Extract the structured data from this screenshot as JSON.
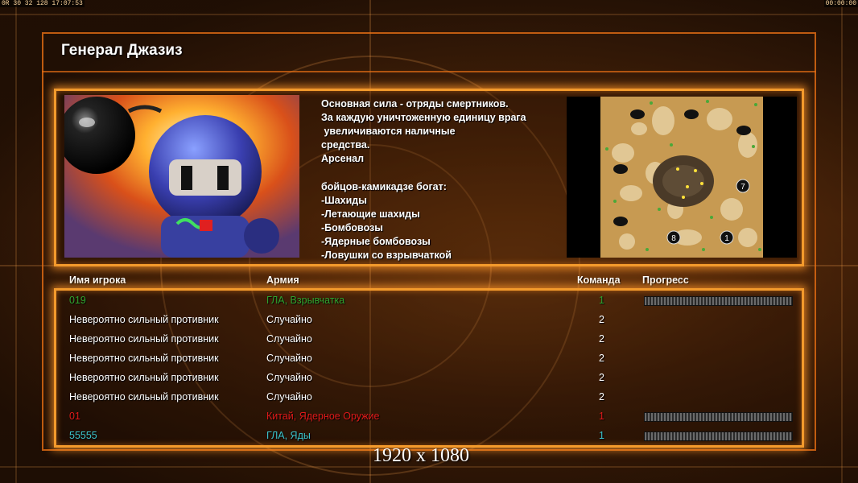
{
  "hud": {
    "left": "0R 30 32 128 17:07:53",
    "right": "00:00:00"
  },
  "title": "Генерал Джазиз",
  "description": "Основная сила - отряды смертников.\nЗа каждую уничтоженную единицу врага\n увеличиваются наличные\nсредства.\nАрсенал\n\nбойцов-камикадзе богат:\n-Шахиды\n-Летающие шахиды\n-Бомбовозы\n-Ядерные бомбовозы\n-Ловушки со взрывчаткой",
  "minimap": {
    "markers": [
      "7",
      "8",
      "1"
    ]
  },
  "columns": {
    "name": "Имя игрока",
    "army": "Армия",
    "team": "Команда",
    "progress": "Прогресс"
  },
  "players": [
    {
      "name": "019",
      "army": "ГЛА, Взрывчатка",
      "team": "1",
      "color": "#2fa42f",
      "progress": 1.0
    },
    {
      "name": "Невероятно сильный противник",
      "army": "Случайно",
      "team": "2",
      "color": "#ffffff"
    },
    {
      "name": "Невероятно сильный противник",
      "army": "Случайно",
      "team": "2",
      "color": "#ffffff"
    },
    {
      "name": "Невероятно сильный противник",
      "army": "Случайно",
      "team": "2",
      "color": "#ffffff"
    },
    {
      "name": "Невероятно сильный противник",
      "army": "Случайно",
      "team": "2",
      "color": "#ffffff"
    },
    {
      "name": "Невероятно сильный противник",
      "army": "Случайно",
      "team": "2",
      "color": "#ffffff"
    },
    {
      "name": "01",
      "army": "Китай, Ядерное Оружие",
      "team": "1",
      "color": "#e01a1a",
      "progress": 1.0
    },
    {
      "name": "55555",
      "army": "ГЛА, Яды",
      "team": "1",
      "color": "#3cc4cc",
      "progress": 1.0
    }
  ],
  "resolution_label": "1920 x 1080"
}
